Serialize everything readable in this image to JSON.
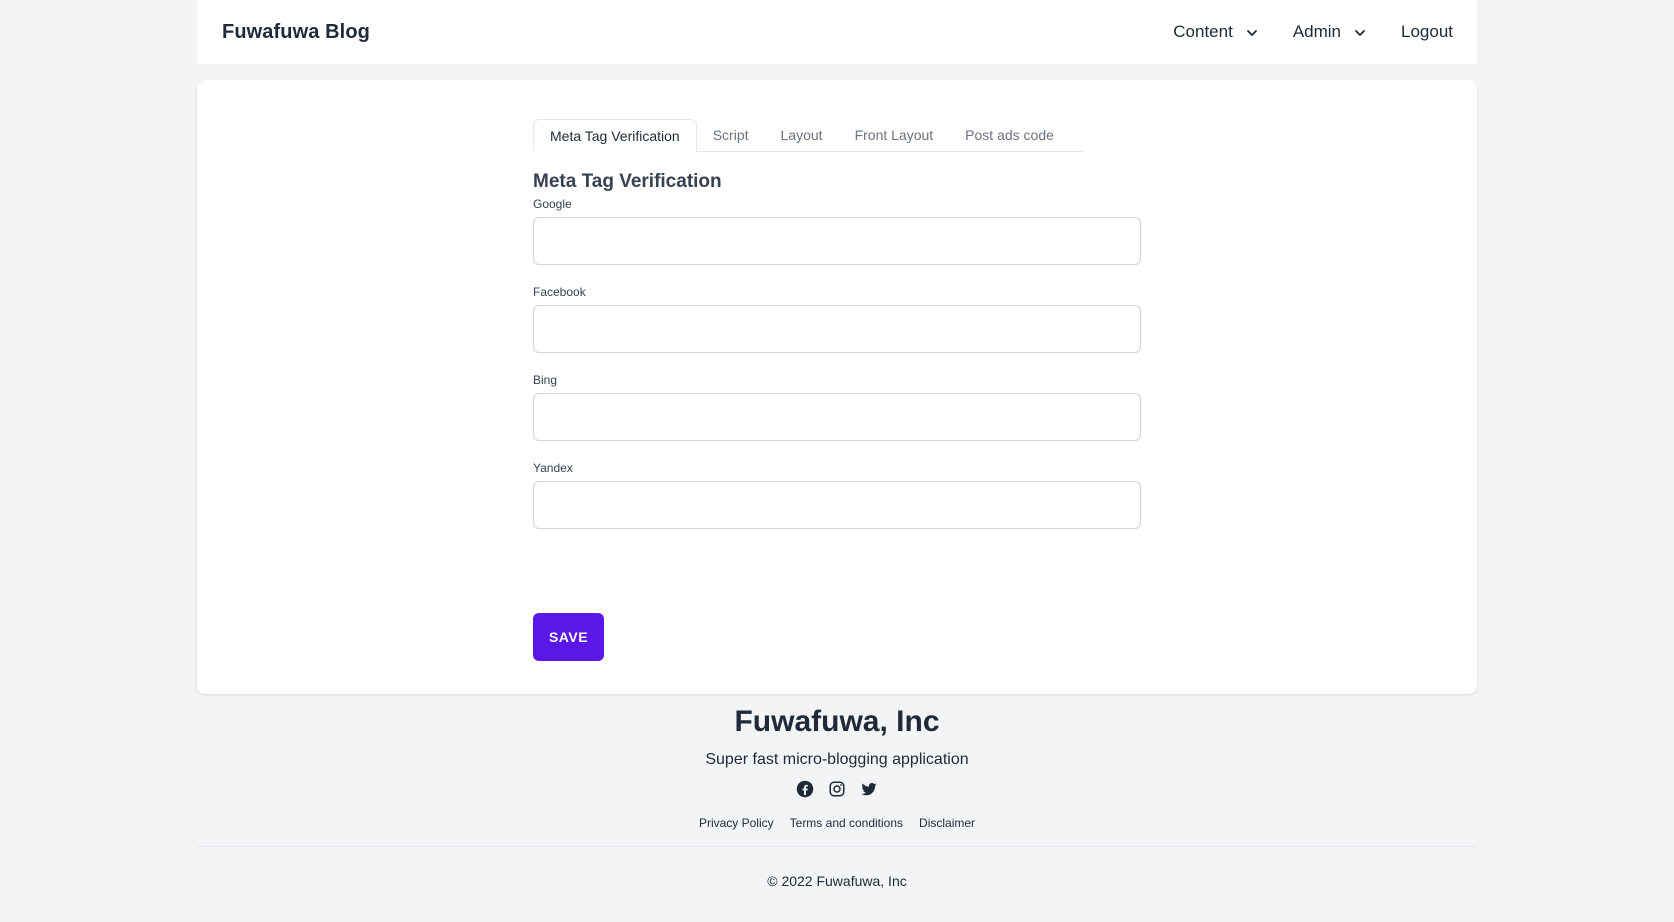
{
  "header": {
    "brand": "Fuwafuwa Blog",
    "nav": {
      "content": "Content",
      "admin": "Admin",
      "logout": "Logout"
    }
  },
  "tabs": [
    {
      "label": "Meta Tag Verification",
      "active": true
    },
    {
      "label": "Script",
      "active": false
    },
    {
      "label": "Layout",
      "active": false
    },
    {
      "label": "Front Layout",
      "active": false
    },
    {
      "label": "Post ads code",
      "active": false
    }
  ],
  "form": {
    "title": "Meta Tag Verification",
    "fields": [
      {
        "label": "Google",
        "value": ""
      },
      {
        "label": "Facebook",
        "value": ""
      },
      {
        "label": "Bing",
        "value": ""
      },
      {
        "label": "Yandex",
        "value": ""
      }
    ],
    "save_label": "SAVE"
  },
  "footer": {
    "company": "Fuwafuwa, Inc",
    "tagline": "Super fast micro-blogging application",
    "social_icons": [
      "facebook-icon",
      "instagram-icon",
      "twitter-icon"
    ],
    "links": [
      "Privacy Policy",
      "Terms and conditions",
      "Disclaimer"
    ],
    "copyright": "© 2022 Fuwafuwa, Inc"
  },
  "colors": {
    "accent": "#5b16e8",
    "background": "#f3f4f6",
    "surface": "#ffffff",
    "text": "#1f2937"
  }
}
